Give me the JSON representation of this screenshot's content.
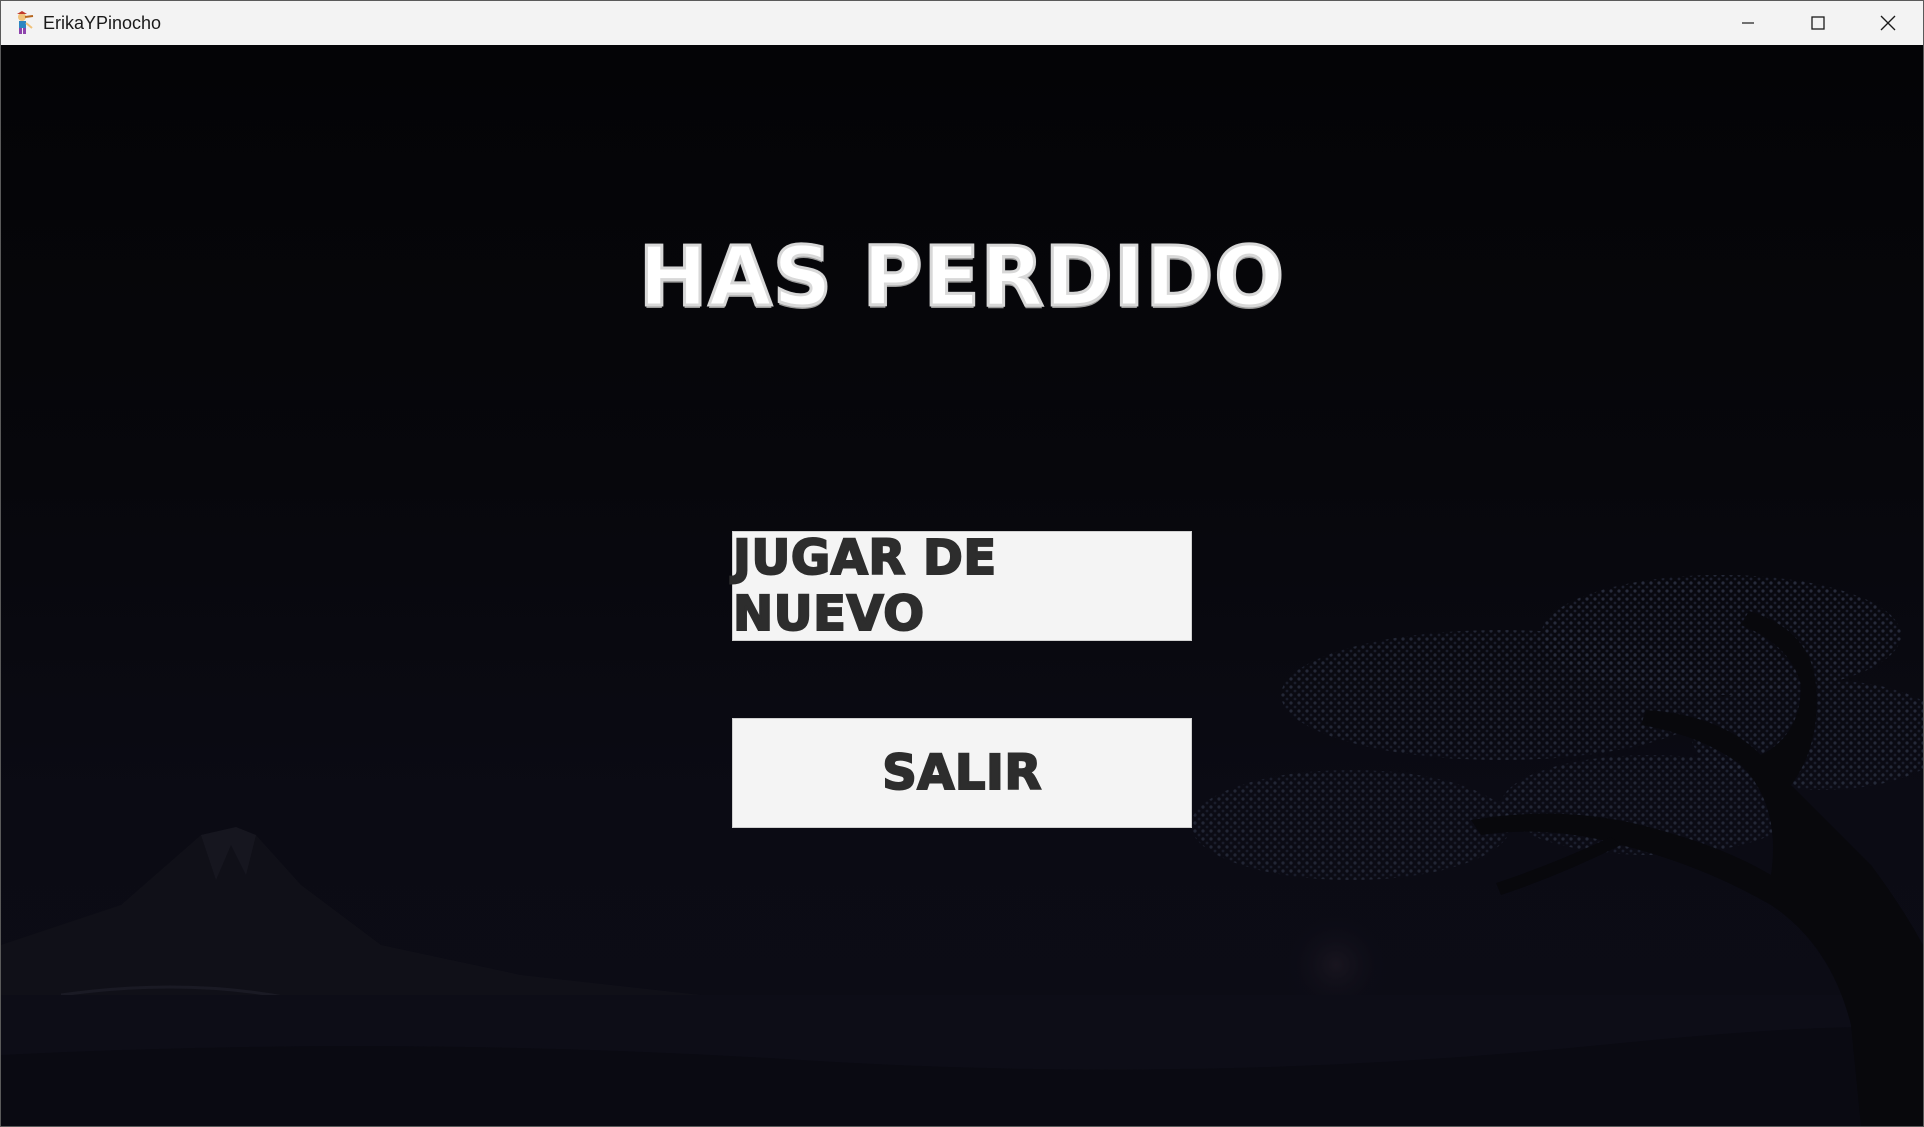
{
  "window": {
    "title": "ErikaYPinocho",
    "icon": "pinocchio-app-icon",
    "controls": {
      "minimize_icon": "minimize-icon",
      "maximize_icon": "maximize-icon",
      "close_icon": "close-icon"
    }
  },
  "game_over": {
    "title": "HAS PERDIDO",
    "play_again_label": "JUGAR DE NUEVO",
    "exit_label": "SALIR"
  },
  "colors": {
    "background": "#07070c",
    "button_bg": "#f4f4f4",
    "button_text": "#2d2d2d",
    "title_text": "#ffffff"
  }
}
